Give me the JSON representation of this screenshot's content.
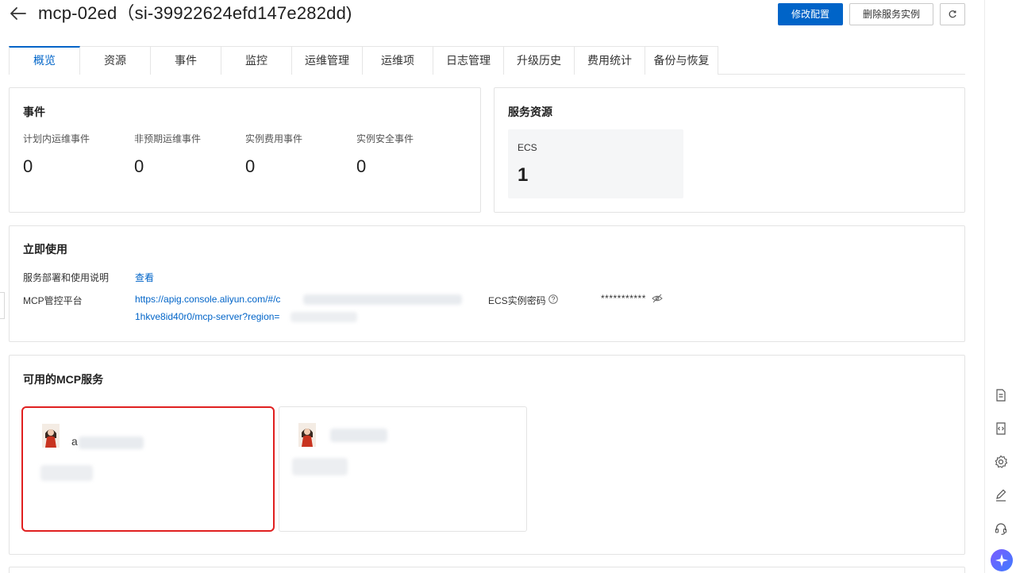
{
  "header": {
    "title": "mcp-02ed（si-39922624efd147e282dd)",
    "primary_button": "修改配置",
    "delete_button": "删除服务实例"
  },
  "tabs": [
    {
      "label": "概览",
      "active": true
    },
    {
      "label": "资源"
    },
    {
      "label": "事件"
    },
    {
      "label": "监控"
    },
    {
      "label": "运维管理"
    },
    {
      "label": "运维项"
    },
    {
      "label": "日志管理"
    },
    {
      "label": "升级历史"
    },
    {
      "label": "费用统计"
    },
    {
      "label": "备份与恢复"
    }
  ],
  "events": {
    "title": "事件",
    "stats": [
      {
        "label": "计划内运维事件",
        "value": "0"
      },
      {
        "label": "非预期运维事件",
        "value": "0"
      },
      {
        "label": "实例费用事件",
        "value": "0"
      },
      {
        "label": "实例安全事件",
        "value": "0"
      }
    ]
  },
  "resources": {
    "title": "服务资源",
    "items": [
      {
        "label": "ECS",
        "value": "1"
      }
    ]
  },
  "usage": {
    "title": "立即使用",
    "deploy_label": "服务部署和使用说明",
    "deploy_link": "查看",
    "platform_label": "MCP管控平台",
    "platform_url_line1": "https://apig.console.aliyun.com/#/c",
    "platform_url_line2": "1hkve8id40r0/mcp-server?region=",
    "password_label": "ECS实例密码",
    "password_value": "***********"
  },
  "mcp": {
    "title": "可用的MCP服务",
    "cards": [
      {
        "name_prefix": "a",
        "selected": true
      },
      {
        "name_prefix": "",
        "selected": false
      }
    ]
  },
  "colors": {
    "primary": "#0064c8",
    "selected_border": "#e02020"
  }
}
